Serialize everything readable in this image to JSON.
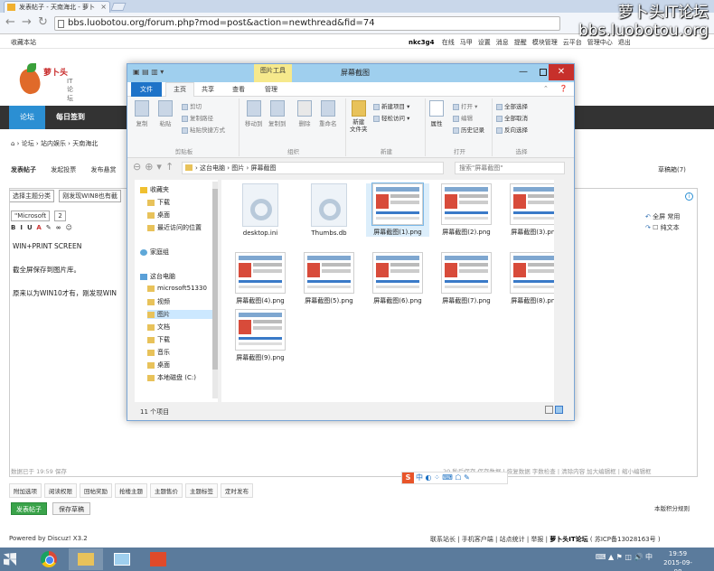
{
  "browser": {
    "tab_title": "发表帖子 - 天南海北 - 萝卜",
    "url": "bbs.luobotou.org/forum.php?mod=post&action=newthread&fid=74"
  },
  "watermark": {
    "line1": "萝卜头IT论坛",
    "line2": "bbs.luobotou.org"
  },
  "forum": {
    "fav_link": "收藏本站",
    "username": "nkc3g4",
    "user_links": [
      "在线",
      "马甲",
      "设置",
      "消息",
      "提醒",
      "模块管理",
      "云平台",
      "管理中心",
      "退出"
    ],
    "logo_text": "萝卜头",
    "logo_sub": "IT论坛",
    "nav": {
      "forum": "论坛",
      "sign": "每日签到"
    },
    "breadcrumb": [
      "论坛",
      "站内娱乐",
      "天南海北"
    ],
    "post_tabs": [
      "发表帖子",
      "发起投票",
      "发布悬赏"
    ],
    "draft_box": "草稿箱(7)",
    "subject_select": "选择主题分类",
    "subject_text": "刚发现WIN8也有截",
    "font_select": "\"Microsoft",
    "size_select": "2",
    "editor_right": [
      "全屏",
      "常用",
      "纯文本"
    ],
    "content": [
      "WIN+PRINT SCREEN",
      "截全屏保存到图片库。",
      "原来以为WIN10才有，刚发现WIN"
    ],
    "status_left": "数据已于 19:59 保存",
    "status_right": "20 秒后保存 保存数据 | 恢复数据   字数检查 | 清除内容   加大编辑框 | 缩小编辑框",
    "attach_buttons": [
      "附加选项",
      "阅读权限",
      "回帖奖励",
      "抢楼主题",
      "主题售价",
      "主题标签",
      "定时发布"
    ],
    "submit": "发表帖子",
    "save_draft": "保存草稿",
    "rules": "本版积分规则",
    "powered": "Powered by Discuz! X3.2",
    "footer_links": "联系站长 | 手机客户端 | 站点统计 | 举报 |",
    "footer_site": "萝卜头IT论坛",
    "footer_icp": "( 苏ICP备13028163号 )"
  },
  "ime": {
    "logo": "S",
    "text": "中 ◐ ⁘ ⌨ ☖ ✎"
  },
  "explorer": {
    "tool_tab": "图片工具",
    "title": "屏幕截图",
    "ribbon_tabs": [
      "文件",
      "主页",
      "共享",
      "查看",
      "管理"
    ],
    "groups": {
      "clipboard": {
        "label": "剪贴板",
        "copy": "复制",
        "paste": "粘贴",
        "cut": "剪切",
        "copy_path": "复制路径",
        "paste_shortcut": "粘贴快捷方式"
      },
      "organize": {
        "label": "组织",
        "move_to": "移动到",
        "copy_to": "复制到",
        "delete": "删除",
        "rename": "重命名"
      },
      "new": {
        "label": "新建",
        "new_folder": "新建\n文件夹",
        "new_item": "新建项目 ▾",
        "easy_access": "轻松访问 ▾"
      },
      "open": {
        "label": "打开",
        "properties": "属性",
        "open": "打开 ▾",
        "edit": "编辑",
        "history": "历史记录"
      },
      "select": {
        "label": "选择",
        "all": "全部选择",
        "none": "全部取消",
        "invert": "反向选择"
      }
    },
    "path": [
      "这台电脑",
      "图片",
      "屏幕截图"
    ],
    "search_placeholder": "搜索\"屏幕截图\"",
    "sidebar": [
      {
        "label": "收藏夹",
        "icon": "star"
      },
      {
        "label": "下载",
        "icon": "folder"
      },
      {
        "label": "桌面",
        "icon": "folder"
      },
      {
        "label": "最近访问的位置",
        "icon": "folder"
      },
      {
        "label": "家庭组",
        "icon": "homegroup"
      },
      {
        "label": "这台电脑",
        "icon": "pc"
      },
      {
        "label": "microsoft51330",
        "icon": "folder"
      },
      {
        "label": "视频",
        "icon": "folder"
      },
      {
        "label": "图片",
        "icon": "folder"
      },
      {
        "label": "文档",
        "icon": "folder"
      },
      {
        "label": "下载",
        "icon": "folder"
      },
      {
        "label": "音乐",
        "icon": "folder"
      },
      {
        "label": "桌面",
        "icon": "folder"
      },
      {
        "label": "本地磁盘 (C:)",
        "icon": "drive"
      }
    ],
    "files": [
      {
        "name": "desktop.ini",
        "type": "gear"
      },
      {
        "name": "Thumbs.db",
        "type": "gear"
      },
      {
        "name": "屏幕截图(1).png",
        "type": "thumb"
      },
      {
        "name": "屏幕截图(2).png",
        "type": "thumb"
      },
      {
        "name": "屏幕截图(3).png",
        "type": "thumb"
      },
      {
        "name": "屏幕截图(4).png",
        "type": "thumb"
      },
      {
        "name": "屏幕截图(5).png",
        "type": "thumb"
      },
      {
        "name": "屏幕截图(6).png",
        "type": "thumb"
      },
      {
        "name": "屏幕截图(7).png",
        "type": "thumb"
      },
      {
        "name": "屏幕截图(8).png",
        "type": "thumb"
      },
      {
        "name": "屏幕截图(9).png",
        "type": "thumb"
      }
    ],
    "status": "11 个项目"
  },
  "taskbar": {
    "tray": "⌨ ▲ ⚑ ◫ 🔊 中",
    "time": "19:59",
    "date": "2015-09-08"
  }
}
